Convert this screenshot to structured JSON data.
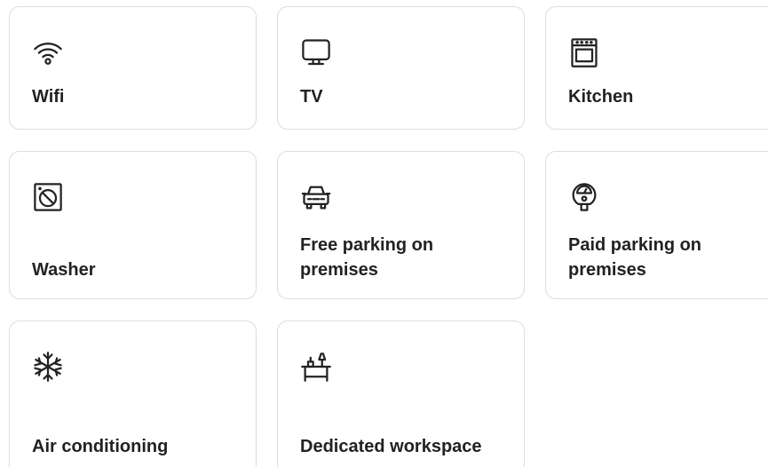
{
  "amenities": [
    {
      "label": "Wifi",
      "icon": "wifi-icon"
    },
    {
      "label": "TV",
      "icon": "tv-icon"
    },
    {
      "label": "Kitchen",
      "icon": "kitchen-icon"
    },
    {
      "label": "Washer",
      "icon": "washer-icon"
    },
    {
      "label": "Free parking on premises",
      "icon": "car-icon"
    },
    {
      "label": "Paid parking on premises",
      "icon": "parking-meter-icon"
    },
    {
      "label": "Air conditioning",
      "icon": "snowflake-icon"
    },
    {
      "label": "Dedicated workspace",
      "icon": "desk-lamp-icon"
    }
  ]
}
